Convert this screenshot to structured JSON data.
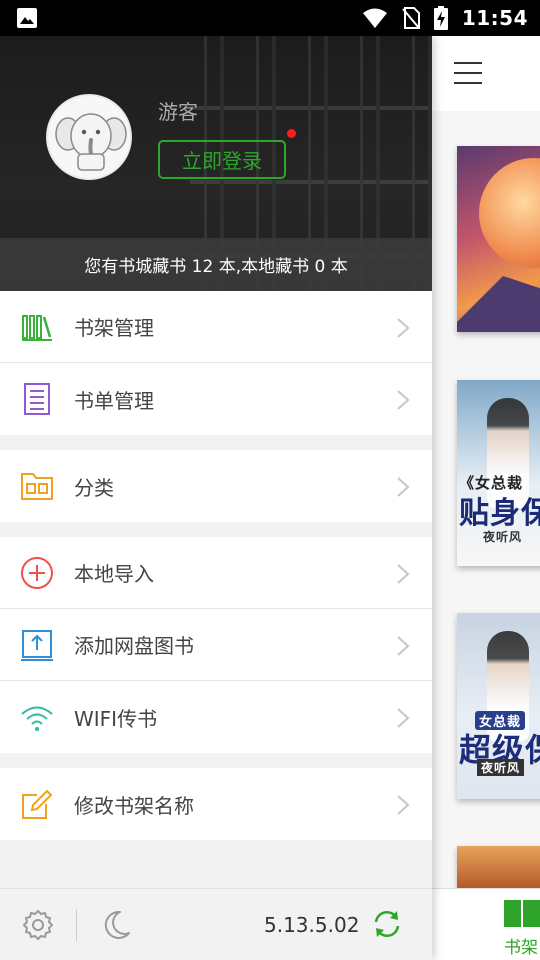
{
  "status_bar": {
    "time": "11:54",
    "icons": [
      "image-icon",
      "wifi-icon",
      "no-sim-icon",
      "battery-charging-icon"
    ]
  },
  "drawer": {
    "header": {
      "username": "游客",
      "login_label": "立即登录",
      "stats_text": "您有书城藏书 12 本,本地藏书 0 本"
    },
    "groups": [
      [
        {
          "label": "书架管理",
          "icon": "bookshelf-icon",
          "color": "#3bb03a"
        },
        {
          "label": "书单管理",
          "icon": "list-icon",
          "color": "#8e5bd0"
        }
      ],
      [
        {
          "label": "分类",
          "icon": "folder-icon",
          "color": "#f0a21e"
        }
      ],
      [
        {
          "label": "本地导入",
          "icon": "add-circle-icon",
          "color": "#f0504a"
        },
        {
          "label": "添加网盘图书",
          "icon": "upload-icon",
          "color": "#2f8fd8"
        },
        {
          "label": "WIFI传书",
          "icon": "wifi-icon",
          "color": "#2fb9a0"
        }
      ],
      [
        {
          "label": "修改书架名称",
          "icon": "edit-icon",
          "color": "#f0a21e"
        }
      ]
    ],
    "footer": {
      "version": "5.13.5.02",
      "accent_color": "#2aa829"
    }
  },
  "background_page": {
    "tab_label": "书架",
    "covers": [
      {
        "title": ""
      },
      {
        "title_1": "《女总裁",
        "title_2": "贴身保",
        "author": "夜听风"
      },
      {
        "title_1": "女总裁",
        "title_2": "超级保",
        "author": "夜听风"
      },
      {
        "title": ""
      }
    ]
  }
}
